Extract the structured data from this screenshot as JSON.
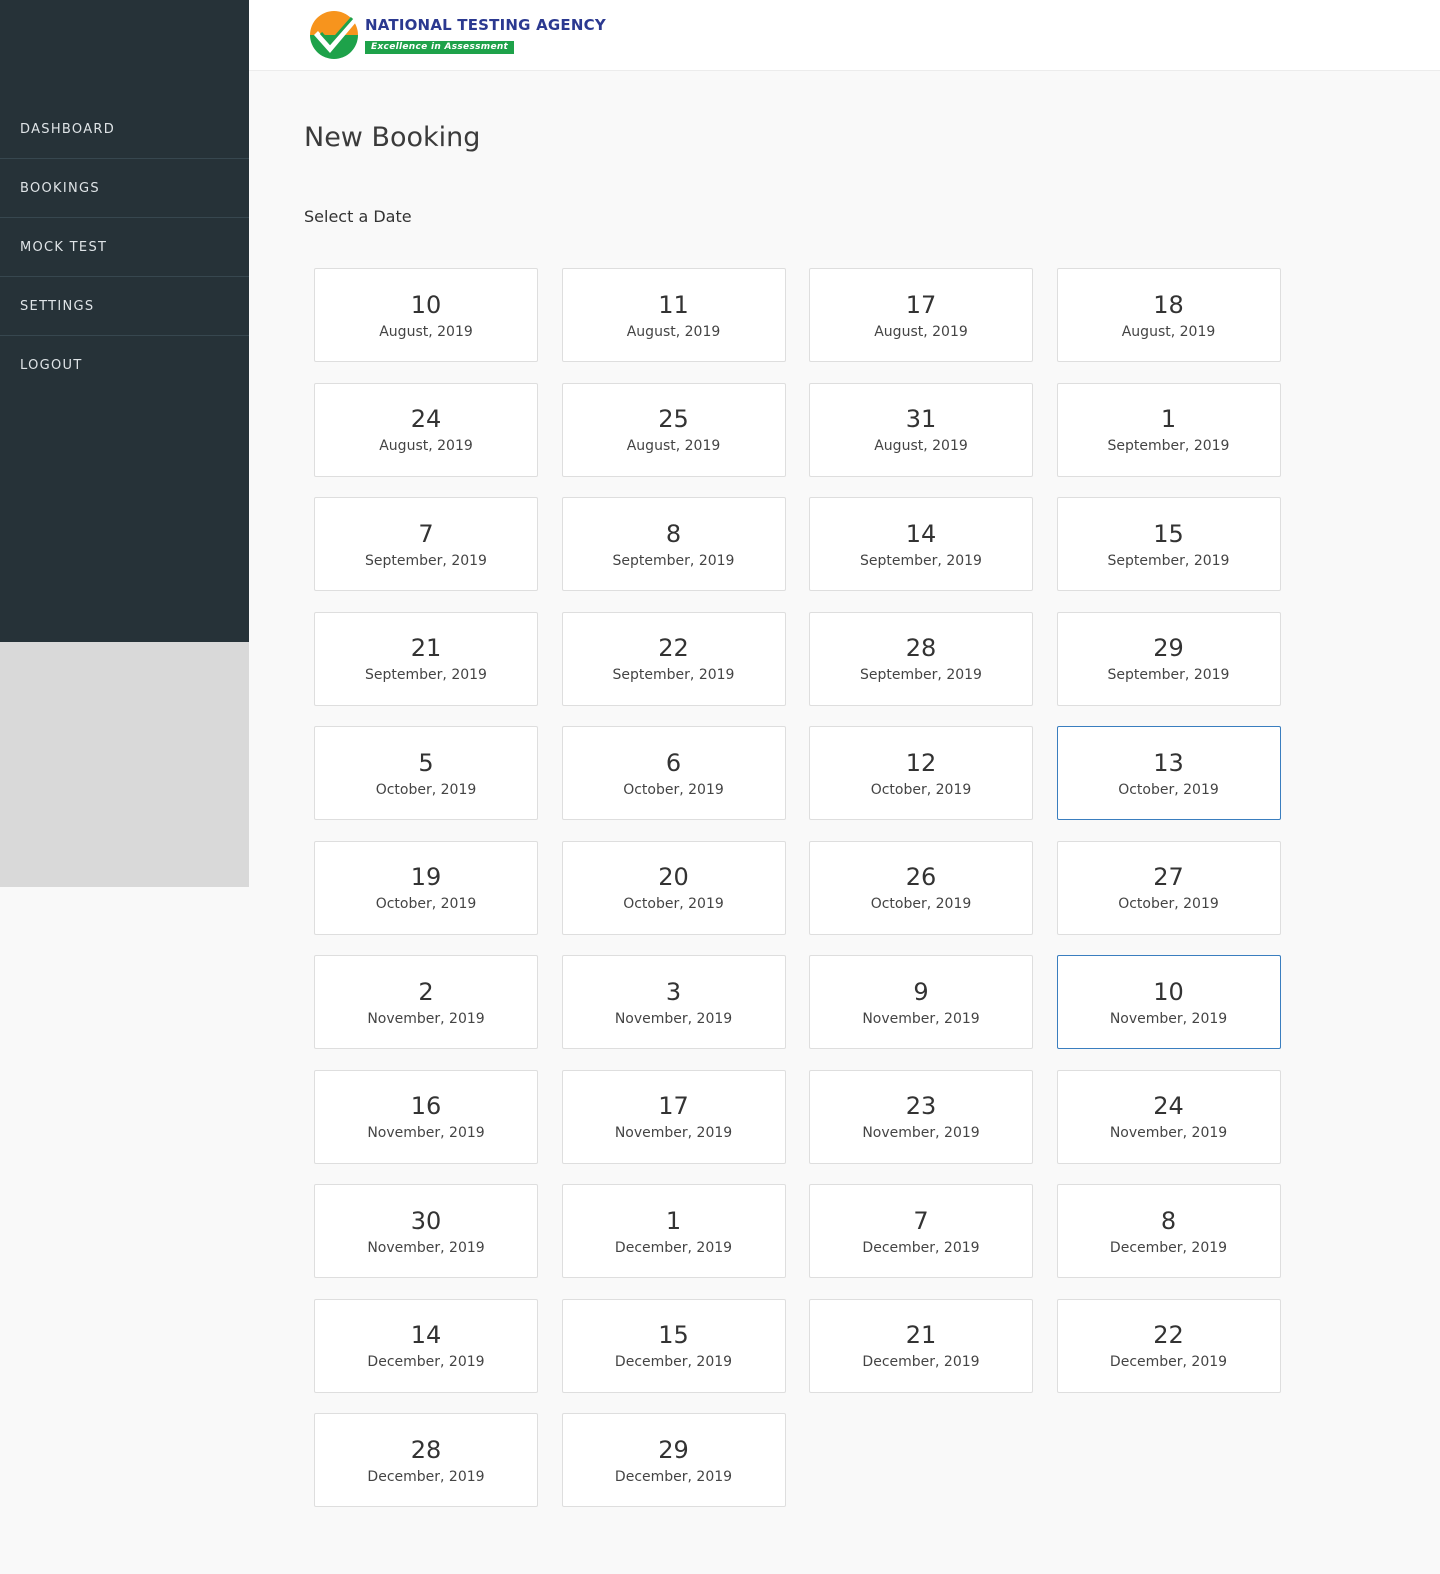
{
  "brand": {
    "title": "NATIONAL TESTING AGENCY",
    "tagline": "Excellence in Assessment",
    "colors": {
      "orange": "#f7941d",
      "green": "#1ea24a",
      "navy": "#2b3990"
    }
  },
  "sidebar": {
    "items": [
      {
        "label": "DASHBOARD"
      },
      {
        "label": "BOOKINGS"
      },
      {
        "label": "MOCK TEST"
      },
      {
        "label": "SETTINGS"
      },
      {
        "label": "LOGOUT"
      }
    ]
  },
  "main": {
    "title": "New Booking",
    "section_label": "Select a Date",
    "selected_color": "#3a7ebf",
    "dates": [
      {
        "day": "10",
        "month": "August, 2019",
        "selected": false
      },
      {
        "day": "11",
        "month": "August, 2019",
        "selected": false
      },
      {
        "day": "17",
        "month": "August, 2019",
        "selected": false
      },
      {
        "day": "18",
        "month": "August, 2019",
        "selected": false
      },
      {
        "day": "24",
        "month": "August, 2019",
        "selected": false
      },
      {
        "day": "25",
        "month": "August, 2019",
        "selected": false
      },
      {
        "day": "31",
        "month": "August, 2019",
        "selected": false
      },
      {
        "day": "1",
        "month": "September, 2019",
        "selected": false
      },
      {
        "day": "7",
        "month": "September, 2019",
        "selected": false
      },
      {
        "day": "8",
        "month": "September, 2019",
        "selected": false
      },
      {
        "day": "14",
        "month": "September, 2019",
        "selected": false
      },
      {
        "day": "15",
        "month": "September, 2019",
        "selected": false
      },
      {
        "day": "21",
        "month": "September, 2019",
        "selected": false
      },
      {
        "day": "22",
        "month": "September, 2019",
        "selected": false
      },
      {
        "day": "28",
        "month": "September, 2019",
        "selected": false
      },
      {
        "day": "29",
        "month": "September, 2019",
        "selected": false
      },
      {
        "day": "5",
        "month": "October, 2019",
        "selected": false
      },
      {
        "day": "6",
        "month": "October, 2019",
        "selected": false
      },
      {
        "day": "12",
        "month": "October, 2019",
        "selected": false
      },
      {
        "day": "13",
        "month": "October, 2019",
        "selected": true
      },
      {
        "day": "19",
        "month": "October, 2019",
        "selected": false
      },
      {
        "day": "20",
        "month": "October, 2019",
        "selected": false
      },
      {
        "day": "26",
        "month": "October, 2019",
        "selected": false
      },
      {
        "day": "27",
        "month": "October, 2019",
        "selected": false
      },
      {
        "day": "2",
        "month": "November, 2019",
        "selected": false
      },
      {
        "day": "3",
        "month": "November, 2019",
        "selected": false
      },
      {
        "day": "9",
        "month": "November, 2019",
        "selected": false
      },
      {
        "day": "10",
        "month": "November, 2019",
        "selected": true
      },
      {
        "day": "16",
        "month": "November, 2019",
        "selected": false
      },
      {
        "day": "17",
        "month": "November, 2019",
        "selected": false
      },
      {
        "day": "23",
        "month": "November, 2019",
        "selected": false
      },
      {
        "day": "24",
        "month": "November, 2019",
        "selected": false
      },
      {
        "day": "30",
        "month": "November, 2019",
        "selected": false
      },
      {
        "day": "1",
        "month": "December, 2019",
        "selected": false
      },
      {
        "day": "7",
        "month": "December, 2019",
        "selected": false
      },
      {
        "day": "8",
        "month": "December, 2019",
        "selected": false
      },
      {
        "day": "14",
        "month": "December, 2019",
        "selected": false
      },
      {
        "day": "15",
        "month": "December, 2019",
        "selected": false
      },
      {
        "day": "21",
        "month": "December, 2019",
        "selected": false
      },
      {
        "day": "22",
        "month": "December, 2019",
        "selected": false
      },
      {
        "day": "28",
        "month": "December, 2019",
        "selected": false
      },
      {
        "day": "29",
        "month": "December, 2019",
        "selected": false
      }
    ]
  }
}
